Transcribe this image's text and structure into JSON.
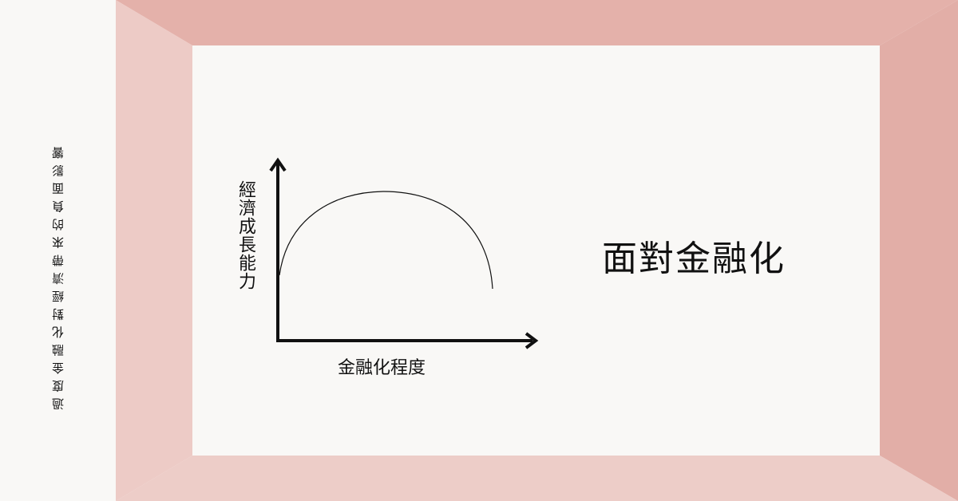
{
  "caption": "過度金融化對經濟帶來的負面影響",
  "headline": "面對金融化",
  "diagram": {
    "y_axis_label": "經濟成長能力",
    "x_axis_label": "金融化程度"
  },
  "colors": {
    "background": "#f9f8f6",
    "frame_top": "#e4b1aa",
    "frame_right": "#e2aea7",
    "frame_left": "#edcbc6",
    "frame_bottom": "#edcdc8",
    "ink": "#111111"
  }
}
